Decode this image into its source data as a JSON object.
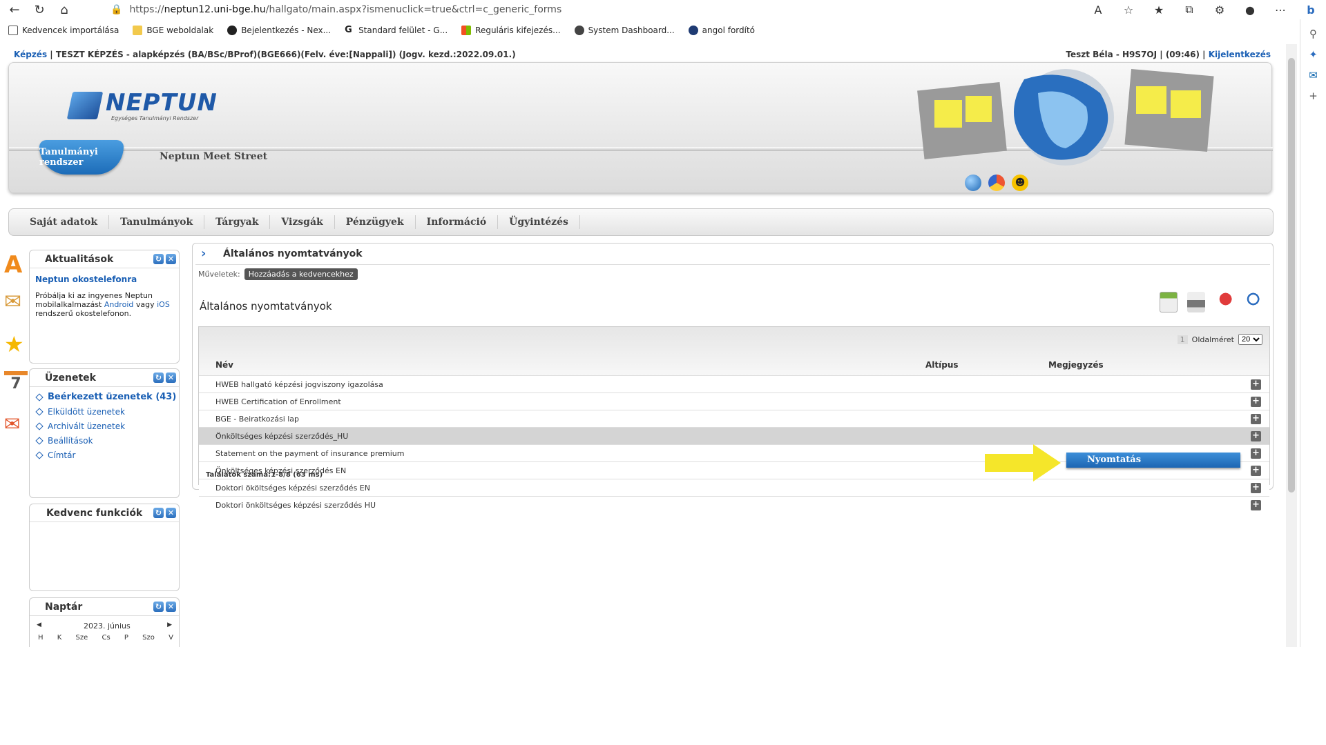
{
  "browser": {
    "url_prefix": "https://",
    "url_domain": "neptun12.uni-bge.hu",
    "url_path": "/hallgato/main.aspx?ismenuclick=true&ctrl=c_generic_forms",
    "bookmarks": [
      {
        "label": "Kedvencek importálása",
        "color": "#ffffff"
      },
      {
        "label": "BGE weboldalak",
        "color": "#f2c94c"
      },
      {
        "label": "Bejelentkezés - Nex...",
        "color": "#222222"
      },
      {
        "label": "Standard felület - G...",
        "color": "#222222"
      },
      {
        "label": "Reguláris kifejezés...",
        "color": "#f25022"
      },
      {
        "label": "System Dashboard...",
        "color": "#444444"
      },
      {
        "label": "angol fordító",
        "color": "#1f3b73"
      }
    ]
  },
  "topline": {
    "left_link": "Képzés",
    "left_text": " |  TESZT KÉPZÉS - alapképzés (BA/BSc/BProf)(BGE666)(Felv. éve:[Nappali]) (Jogv. kezd.:2022.09.01.)",
    "user": "Teszt Béla - H9S7OJ",
    "timer": "(09:46)",
    "logout": "Kijelentkezés"
  },
  "header": {
    "logo": "NEPTUN",
    "logo_sub": "Egységes Tanulmányi Rendszer",
    "tab_active": "Tanulmányi rendszer",
    "tab_other": "Neptun Meet Street"
  },
  "menu": [
    "Saját adatok",
    "Tanulmányok",
    "Tárgyak",
    "Vizsgák",
    "Pénzügyek",
    "Információ",
    "Ügyintézés"
  ],
  "sidebar": {
    "news": {
      "title": "Aktualitások",
      "headline": "Neptun okostelefonra",
      "text1": "Próbálja ki az ingyenes Neptun mobilalkalmazást ",
      "link1": "Android",
      "text2": " vagy ",
      "link2": "iOS",
      "text3": " rendszerű okostelefonon."
    },
    "messages": {
      "title": "Üzenetek",
      "items": [
        "Beérkezett üzenetek (43)",
        "Elküldött üzenetek",
        "Archivált üzenetek",
        "Beállítások",
        "Címtár"
      ]
    },
    "favorites": {
      "title": "Kedvenc funkciók"
    },
    "calendar": {
      "title": "Naptár",
      "month": "2023. június",
      "days": [
        "H",
        "K",
        "Sze",
        "Cs",
        "P",
        "Szo",
        "V"
      ]
    }
  },
  "content": {
    "breadcrumb": "Általános nyomtatványok",
    "ops_label": "Műveletek:",
    "add_fav": "Hozzáadás a kedvencekhez",
    "grid_title": "Általános nyomtatványok",
    "page_num": "1",
    "page_size_label": "Oldalméret",
    "page_size": "20",
    "columns": {
      "name": "Név",
      "subtype": "Altípus",
      "note": "Megjegyzés"
    },
    "rows": [
      "HWEB hallgató képzési jogviszony igazolása",
      "HWEB Certification of Enrollment",
      "BGE - Beiratkozási lap",
      "Önköltséges képzési szerződés_HU",
      "Statement on the payment of insurance premium",
      "Önköltséges képzési szerződés EN",
      "Doktori ököltséges képzési szerződés EN",
      "Doktori önköltséges képzési szerződés HU"
    ],
    "selected_row": 3,
    "found": "Találatok száma:1-8/8 (63 ms)",
    "popup": "Nyomtatás"
  },
  "colors": {
    "accent": "#1d66b3",
    "link": "#1a5fb4",
    "arrow": "#f5e62a"
  }
}
